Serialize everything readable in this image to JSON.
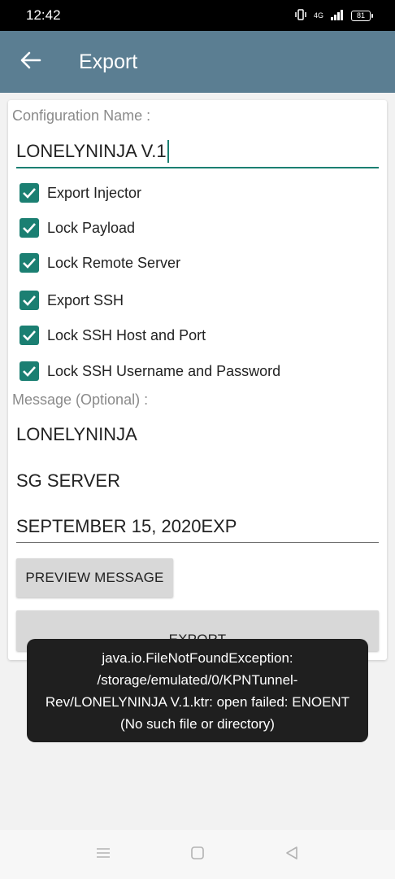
{
  "status_bar": {
    "time": "12:42",
    "network": "4G",
    "battery": "81"
  },
  "app_bar": {
    "title": "Export"
  },
  "form": {
    "config_label": "Configuration Name :",
    "config_value": "LONELYNINJA V.1",
    "checkboxes": [
      {
        "label": "Export Injector",
        "checked": true
      },
      {
        "label": "Lock Payload",
        "checked": true
      },
      {
        "label": "Lock Remote Server",
        "checked": true
      },
      {
        "label": "Export SSH",
        "checked": true
      },
      {
        "label": "Lock SSH Host and Port",
        "checked": true
      },
      {
        "label": "Lock SSH Username and Password",
        "checked": true
      }
    ],
    "message_label": "Message (Optional) :",
    "message_lines": [
      "LONELYNINJA",
      "SG SERVER",
      "SEPTEMBER 15, 2020EXP"
    ],
    "preview_button": "PREVIEW MESSAGE",
    "export_button": "EXPORT"
  },
  "toast": {
    "text": "java.io.FileNotFoundException: /storage/emulated/0/KPNTunnel-Rev/LONELYNINJA V.1.ktr: open failed: ENOENT (No such file or directory)"
  },
  "colors": {
    "app_bar": "#5b7e92",
    "accent": "#1b7f72",
    "toast_bg": "#1f1f1f"
  }
}
